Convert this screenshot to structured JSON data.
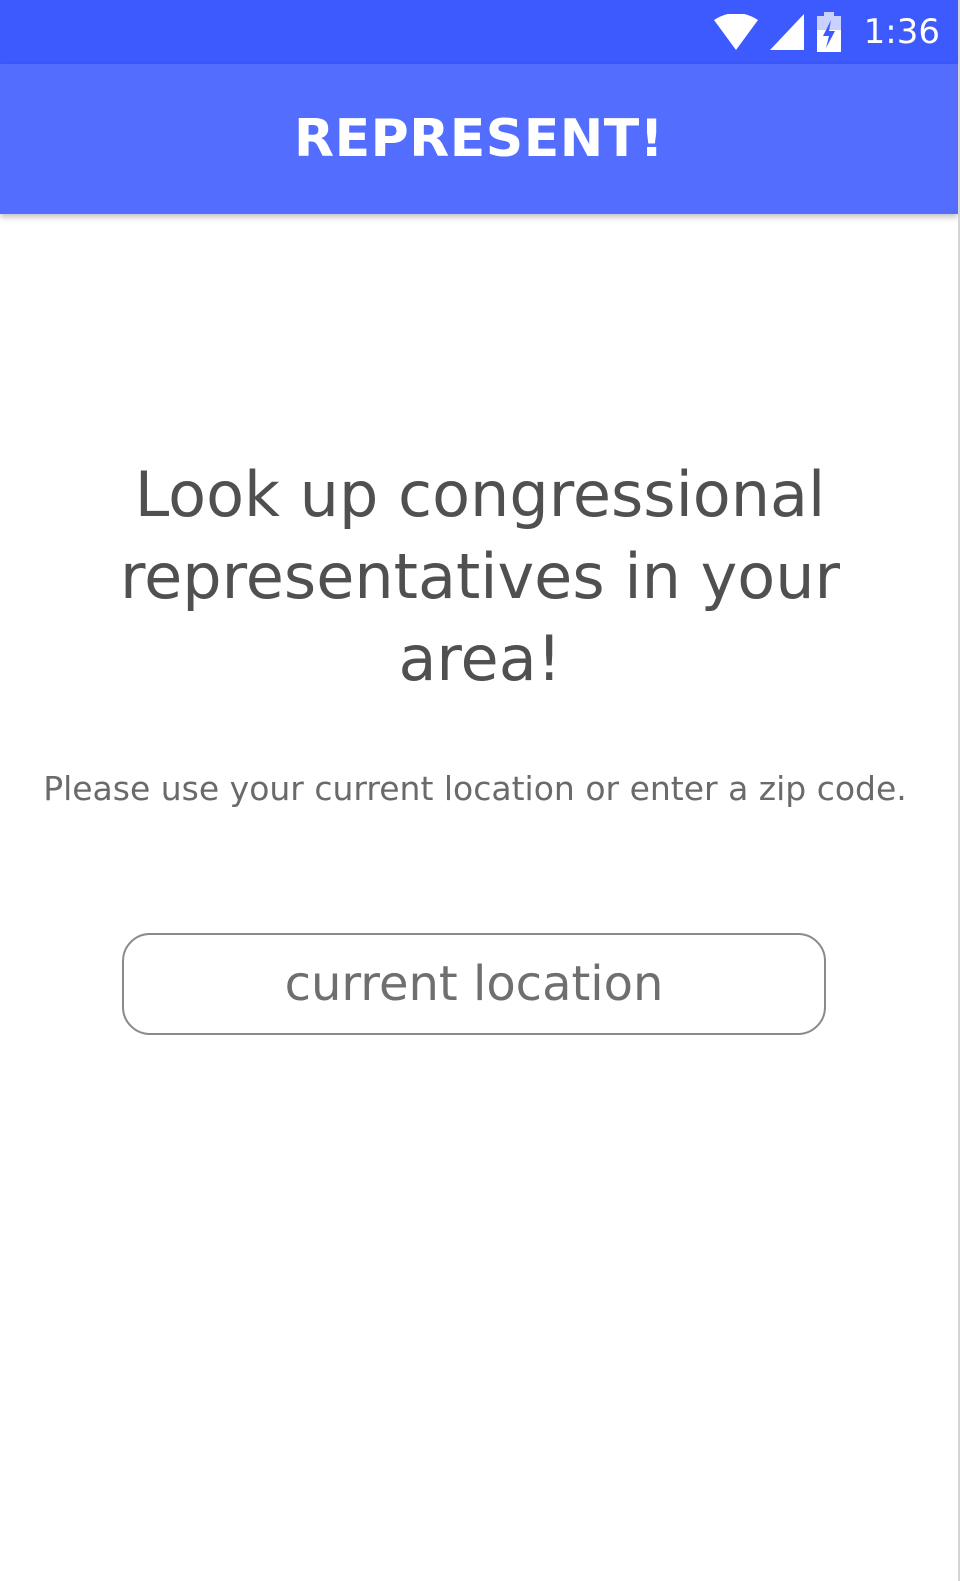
{
  "status_bar": {
    "time": "1:36",
    "icons": [
      "wifi-icon",
      "cell-signal-icon",
      "battery-charging-icon"
    ],
    "background": "#3d5afe"
  },
  "app_bar": {
    "title": "REPRESENT!",
    "background": "#536dfe"
  },
  "main": {
    "headline": "Look up congressional representatives in your area!",
    "instruction": "Please use your current location or enter a zip code.",
    "location_button_label": "current location"
  },
  "colors": {
    "headline_text": "#505050",
    "instruction_text": "#6a6a6a",
    "button_border": "#8a8a8a"
  }
}
